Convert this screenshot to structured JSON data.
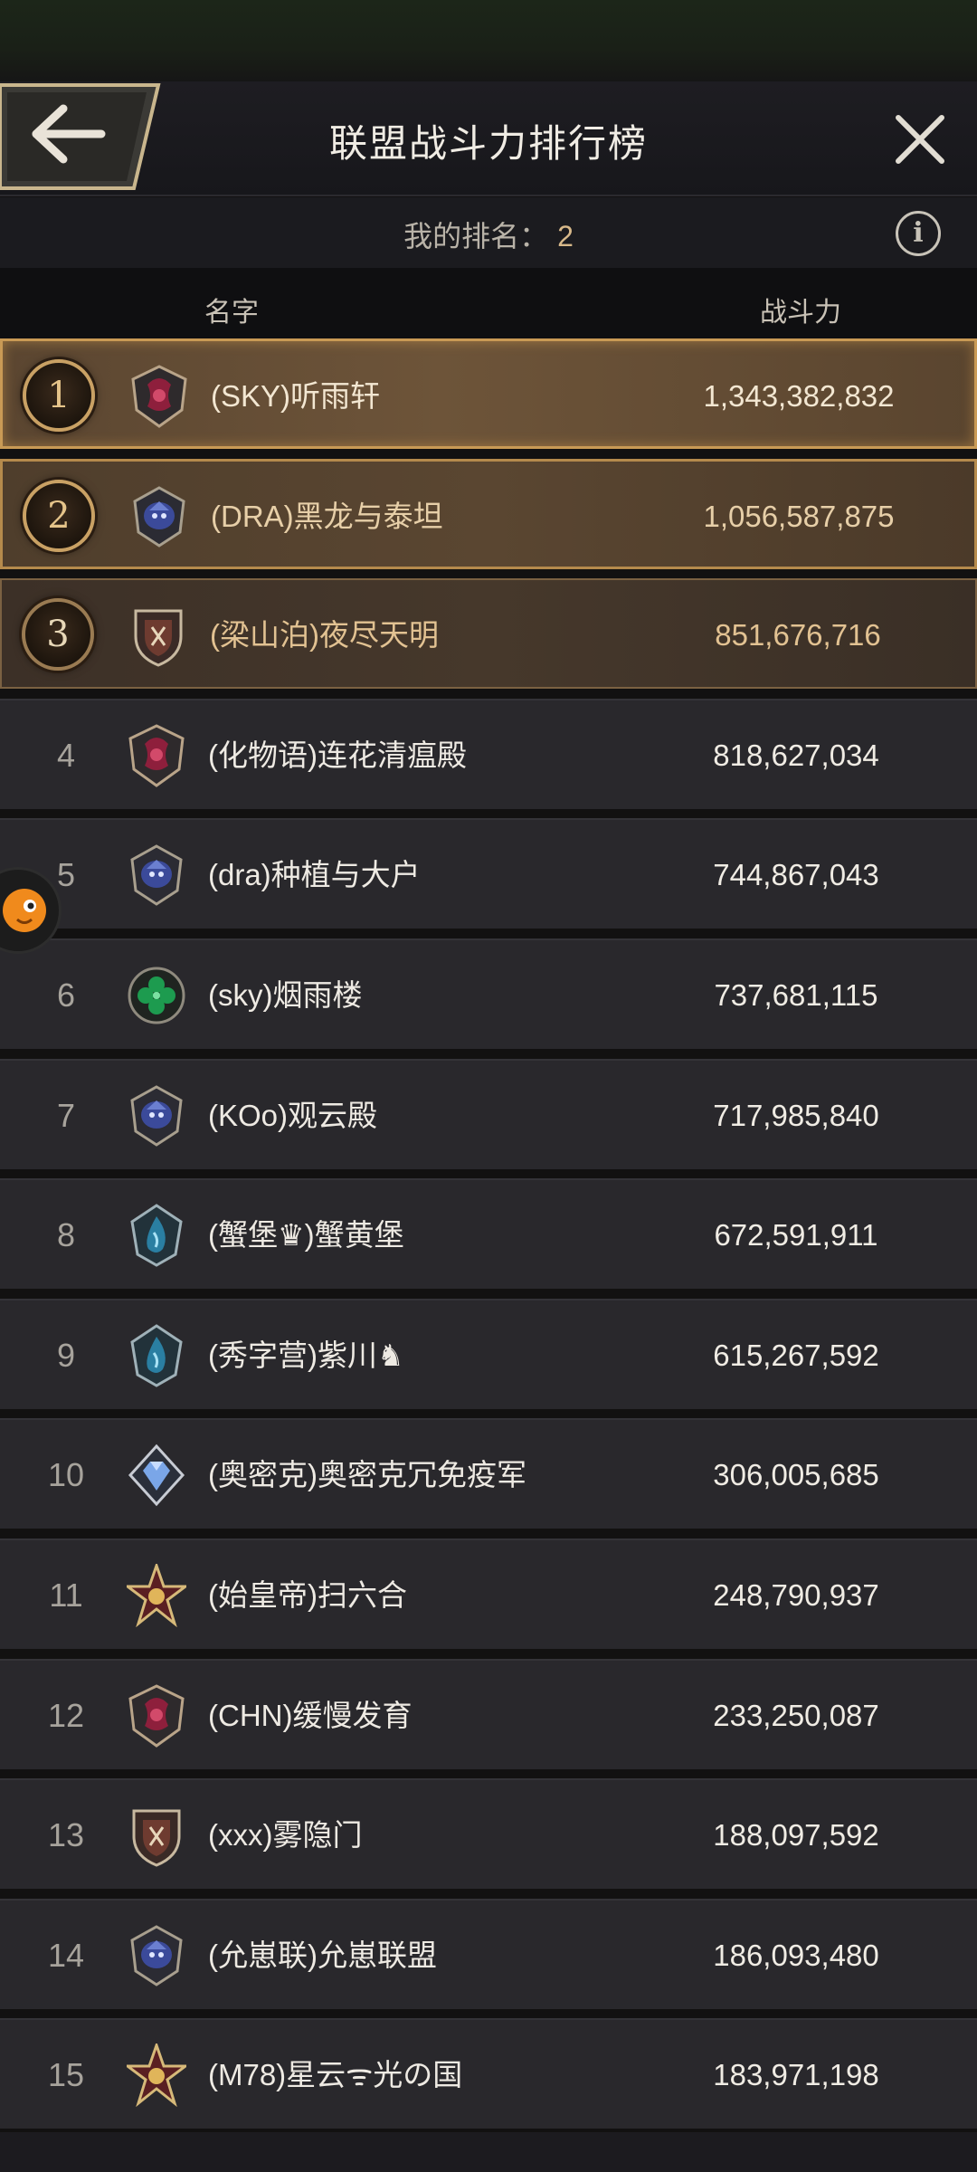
{
  "header": {
    "title": "联盟战斗力排行榜",
    "back_icon": "back-arrow-icon",
    "close_icon": "close-icon"
  },
  "my_rank": {
    "label": "我的排名：",
    "value": "2",
    "info_icon": "info-icon",
    "info_glyph": "i"
  },
  "columns": {
    "name": "名字",
    "power": "战斗力"
  },
  "rows": [
    {
      "rank": "1",
      "name": "(SKY)听雨轩",
      "power": "1,343,382,832",
      "emblem": "crimson-dragon-emblem"
    },
    {
      "rank": "2",
      "name": "(DRA)黑龙与泰坦",
      "power": "1,056,587,875",
      "emblem": "blue-beast-emblem"
    },
    {
      "rank": "3",
      "name": "(梁山泊)夜尽天明",
      "power": "851,676,716",
      "emblem": "shield-emblem"
    },
    {
      "rank": "4",
      "name": "(化物语)连花清瘟殿",
      "power": "818,627,034",
      "emblem": "crimson-dragon-emblem"
    },
    {
      "rank": "5",
      "name": "(dra)种植与大户",
      "power": "744,867,043",
      "emblem": "blue-beast-emblem"
    },
    {
      "rank": "6",
      "name": "(sky)烟雨楼",
      "power": "737,681,115",
      "emblem": "clover-emblem"
    },
    {
      "rank": "7",
      "name": "(KOo)观云殿",
      "power": "717,985,840",
      "emblem": "blue-beast-emblem"
    },
    {
      "rank": "8",
      "name": "(蟹堡♛)蟹黄堡",
      "power": "672,591,911",
      "emblem": "water-emblem"
    },
    {
      "rank": "9",
      "name": "(秀字营)紫川♞",
      "power": "615,267,592",
      "emblem": "water-emblem"
    },
    {
      "rank": "10",
      "name": "(奥密克)奥密克冗免疫军",
      "power": "306,005,685",
      "emblem": "diamond-emblem"
    },
    {
      "rank": "11",
      "name": "(始皇帝)扫六合",
      "power": "248,790,937",
      "emblem": "star-emblem"
    },
    {
      "rank": "12",
      "name": "(CHN)缓慢发育",
      "power": "233,250,087",
      "emblem": "crimson-dragon-emblem"
    },
    {
      "rank": "13",
      "name": "(xxx)雾隐门",
      "power": "188,097,592",
      "emblem": "shield-emblem"
    },
    {
      "rank": "14",
      "name": "(允崽联)允崽联盟",
      "power": "186,093,480",
      "emblem": "blue-beast-emblem"
    },
    {
      "rank": "15",
      "name": "(M78)星云ᯤ光の国",
      "power": "183,971,198",
      "emblem": "star-emblem"
    }
  ],
  "colors": {
    "gold": "#c99a55",
    "row_bg": "#29282c",
    "crimson": "#8e1f3c",
    "blue": "#3b4a9a",
    "green": "#1d9b4f",
    "teal": "#2a7fa2"
  }
}
